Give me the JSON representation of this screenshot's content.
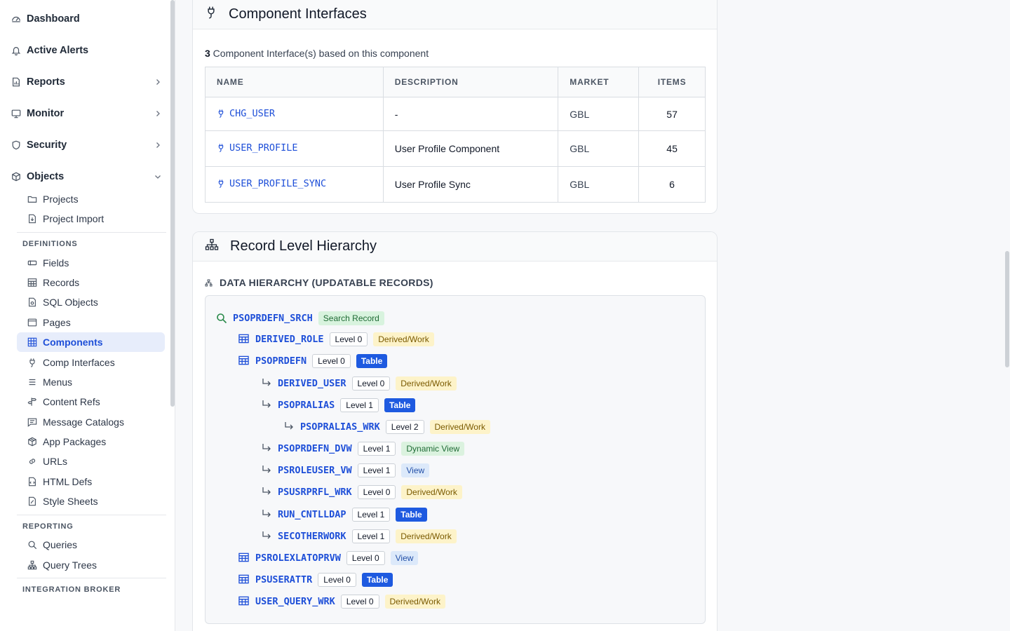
{
  "sidebar": {
    "main": [
      {
        "label": "Dashboard",
        "icon": "dashboard-icon"
      },
      {
        "label": "Active Alerts",
        "icon": "bell-icon"
      },
      {
        "label": "Reports",
        "icon": "report-icon"
      },
      {
        "label": "Monitor",
        "icon": "monitor-icon"
      },
      {
        "label": "Security",
        "icon": "shield-icon"
      },
      {
        "label": "Objects",
        "icon": "cube-icon"
      }
    ],
    "objects_items": [
      {
        "label": "Projects",
        "icon": "folder-icon"
      },
      {
        "label": "Project Import",
        "icon": "file-import-icon"
      }
    ],
    "definitions_header": "DEFINITIONS",
    "definitions": [
      {
        "label": "Fields",
        "icon": "field-icon"
      },
      {
        "label": "Records",
        "icon": "table-icon"
      },
      {
        "label": "SQL Objects",
        "icon": "sql-file-icon"
      },
      {
        "label": "Pages",
        "icon": "page-icon"
      },
      {
        "label": "Components",
        "icon": "grid-icon"
      },
      {
        "label": "Comp Interfaces",
        "icon": "plug-icon"
      },
      {
        "label": "Menus",
        "icon": "menu-icon"
      },
      {
        "label": "Content Refs",
        "icon": "signpost-icon"
      },
      {
        "label": "Message Catalogs",
        "icon": "message-icon"
      },
      {
        "label": "App Packages",
        "icon": "package-icon"
      },
      {
        "label": "URLs",
        "icon": "link-icon"
      },
      {
        "label": "HTML Defs",
        "icon": "html-file-icon"
      },
      {
        "label": "Style Sheets",
        "icon": "stylesheet-icon"
      }
    ],
    "reporting_header": "REPORTING",
    "reporting": [
      {
        "label": "Queries",
        "icon": "search-icon"
      },
      {
        "label": "Query Trees",
        "icon": "hierarchy-icon"
      }
    ],
    "integration_header": "INTEGRATION BROKER"
  },
  "component_interfaces": {
    "title": "Component Interfaces",
    "count": "3",
    "count_suffix": " Component Interface(s) based on this component",
    "columns": [
      "NAME",
      "DESCRIPTION",
      "MARKET",
      "ITEMS"
    ],
    "rows": [
      {
        "name": "CHG_USER",
        "description": "-",
        "market": "GBL",
        "items": "57"
      },
      {
        "name": "USER_PROFILE",
        "description": "User Profile Component",
        "market": "GBL",
        "items": "45"
      },
      {
        "name": "USER_PROFILE_SYNC",
        "description": "User Profile Sync",
        "market": "GBL",
        "items": "6"
      }
    ]
  },
  "hierarchy": {
    "title": "Record Level Hierarchy",
    "label": "DATA HIERARCHY (UPDATABLE RECORDS)",
    "nodes": [
      {
        "name": "PSOPRDEFN_SRCH",
        "level": "",
        "badge": "Search Record",
        "kind": "sr",
        "icon": "search-icon"
      },
      {
        "name": "DERIVED_ROLE",
        "level": "Level 0",
        "badge": "Derived/Work",
        "kind": "dw",
        "icon": "table-icon"
      },
      {
        "name": "PSOPRDEFN",
        "level": "Level 0",
        "badge": "Table",
        "kind": "tb",
        "icon": "table-icon"
      },
      {
        "name": "DERIVED_USER",
        "level": "Level 0",
        "badge": "Derived/Work",
        "kind": "dw",
        "icon": "child-arrow-icon"
      },
      {
        "name": "PSOPRALIAS",
        "level": "Level 1",
        "badge": "Table",
        "kind": "tb",
        "icon": "child-arrow-icon"
      },
      {
        "name": "PSOPRALIAS_WRK",
        "level": "Level 2",
        "badge": "Derived/Work",
        "kind": "dw",
        "icon": "child-arrow-icon"
      },
      {
        "name": "PSOPRDEFN_DVW",
        "level": "Level 1",
        "badge": "Dynamic View",
        "kind": "dv",
        "icon": "child-arrow-icon"
      },
      {
        "name": "PSROLEUSER_VW",
        "level": "Level 1",
        "badge": "View",
        "kind": "vw",
        "icon": "child-arrow-icon"
      },
      {
        "name": "PSUSRPRFL_WRK",
        "level": "Level 0",
        "badge": "Derived/Work",
        "kind": "dw",
        "icon": "child-arrow-icon"
      },
      {
        "name": "RUN_CNTLLDAP",
        "level": "Level 1",
        "badge": "Table",
        "kind": "tb",
        "icon": "child-arrow-icon"
      },
      {
        "name": "SECOTHERWORK",
        "level": "Level 1",
        "badge": "Derived/Work",
        "kind": "dw",
        "icon": "child-arrow-icon"
      },
      {
        "name": "PSROLEXLATOPRVW",
        "level": "Level 0",
        "badge": "View",
        "kind": "vw",
        "icon": "table-icon"
      },
      {
        "name": "PSUSERATTR",
        "level": "Level 0",
        "badge": "Table",
        "kind": "tb",
        "icon": "table-icon"
      },
      {
        "name": "USER_QUERY_WRK",
        "level": "Level 0",
        "badge": "Derived/Work",
        "kind": "dw",
        "icon": "table-icon"
      }
    ]
  }
}
